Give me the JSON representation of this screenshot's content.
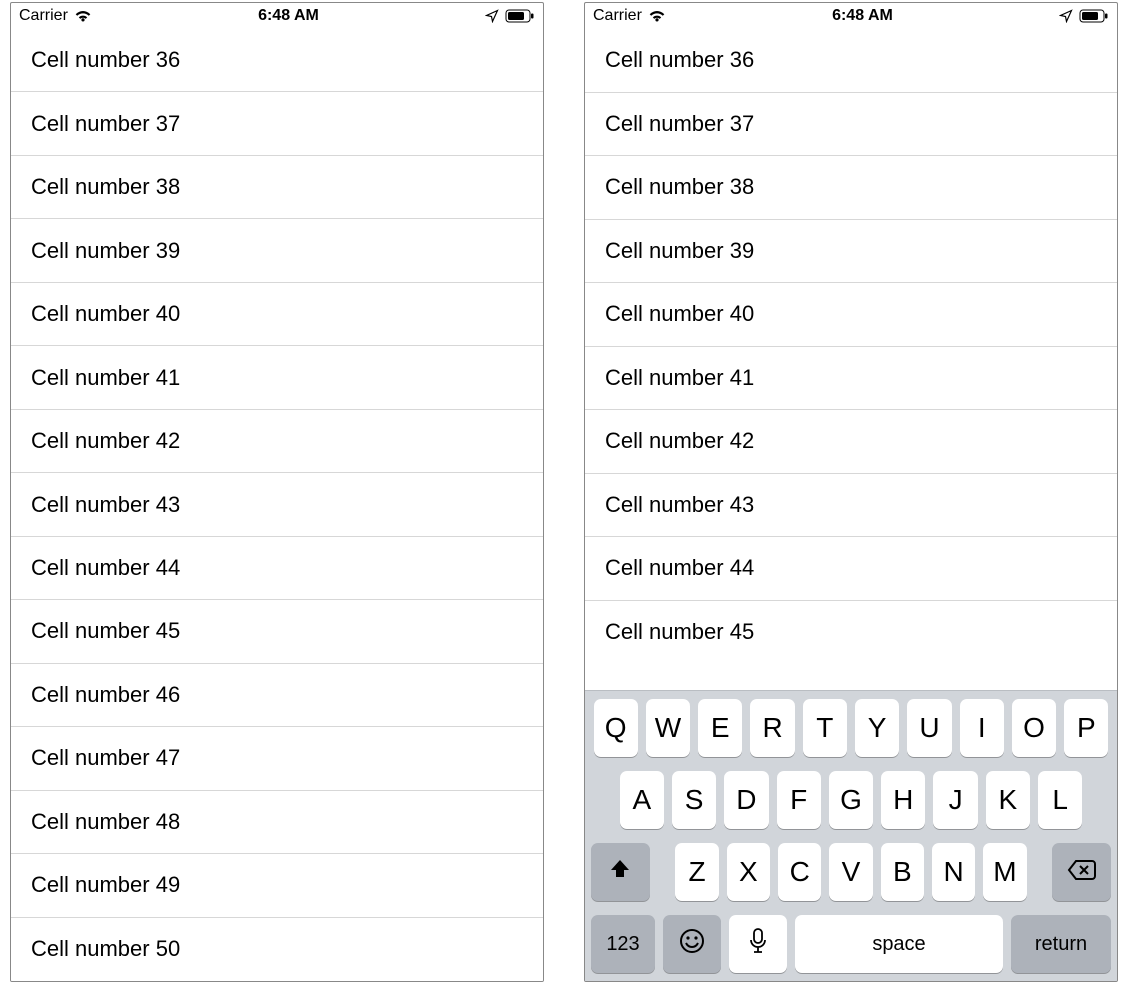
{
  "status": {
    "carrier": "Carrier",
    "time": "6:48 AM"
  },
  "left": {
    "cells": [
      "Cell number 36",
      "Cell number 37",
      "Cell number 38",
      "Cell number 39",
      "Cell number 40",
      "Cell number 41",
      "Cell number 42",
      "Cell number 43",
      "Cell number 44",
      "Cell number 45",
      "Cell number 46",
      "Cell number 47",
      "Cell number 48",
      "Cell number 49",
      "Cell number 50"
    ]
  },
  "right": {
    "cells": [
      "Cell number 36",
      "Cell number 37",
      "Cell number 38",
      "Cell number 39",
      "Cell number 40",
      "Cell number 41",
      "Cell number 42",
      "Cell number 43",
      "Cell number 44",
      "Cell number 45"
    ]
  },
  "keyboard": {
    "row1": [
      "Q",
      "W",
      "E",
      "R",
      "T",
      "Y",
      "U",
      "I",
      "O",
      "P"
    ],
    "row2": [
      "A",
      "S",
      "D",
      "F",
      "G",
      "H",
      "J",
      "K",
      "L"
    ],
    "row3": [
      "Z",
      "X",
      "C",
      "V",
      "B",
      "N",
      "M"
    ],
    "num_label": "123",
    "space_label": "space",
    "return_label": "return"
  }
}
